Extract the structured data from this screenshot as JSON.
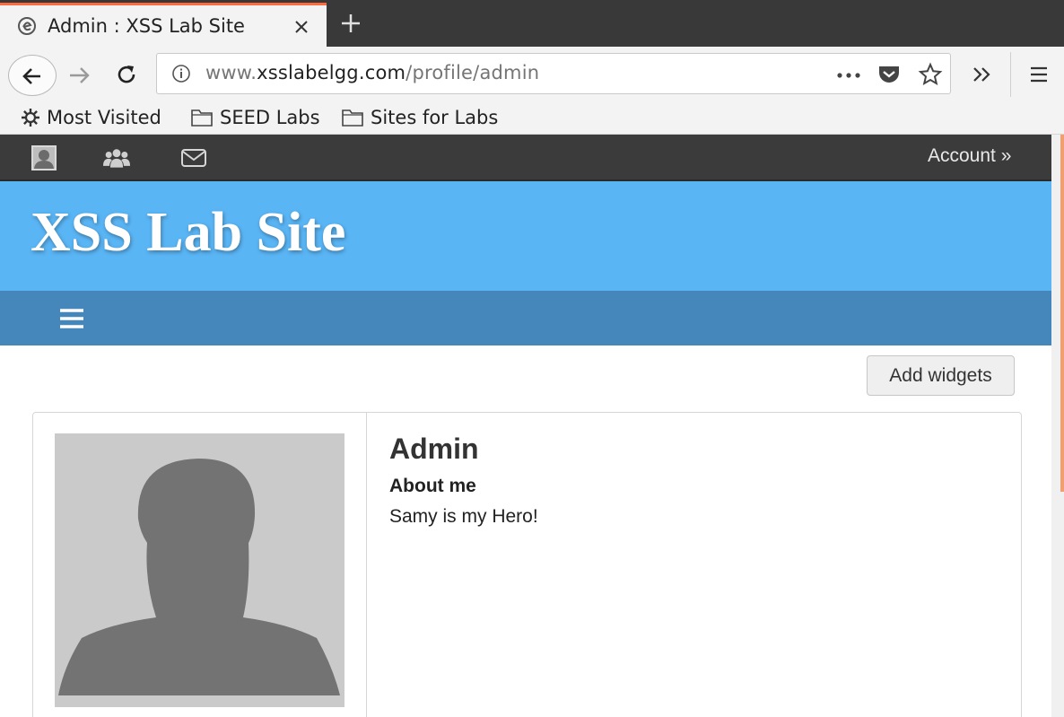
{
  "browser": {
    "tab_title": "Admin : XSS Lab Site",
    "url_prefix": "www.",
    "url_host": "xsslabelgg.com",
    "url_path": "/profile/admin",
    "bookmarks": [
      {
        "label": "Most Visited",
        "icon": "gear-icon"
      },
      {
        "label": "SEED Labs",
        "icon": "folder-icon"
      },
      {
        "label": "Sites for Labs",
        "icon": "folder-icon"
      }
    ],
    "accent_color": "#ff6a3d"
  },
  "topbar": {
    "account_label": "Account »",
    "icons": [
      "profile-icon",
      "friends-icon",
      "mail-icon"
    ]
  },
  "header": {
    "site_title": "XSS Lab Site",
    "header_color": "#5ab5f5",
    "nav_color": "#4587ba"
  },
  "main": {
    "add_widgets_label": "Add widgets",
    "profile": {
      "name": "Admin",
      "about_label": "About me",
      "about_text": "Samy is my Hero!"
    }
  }
}
